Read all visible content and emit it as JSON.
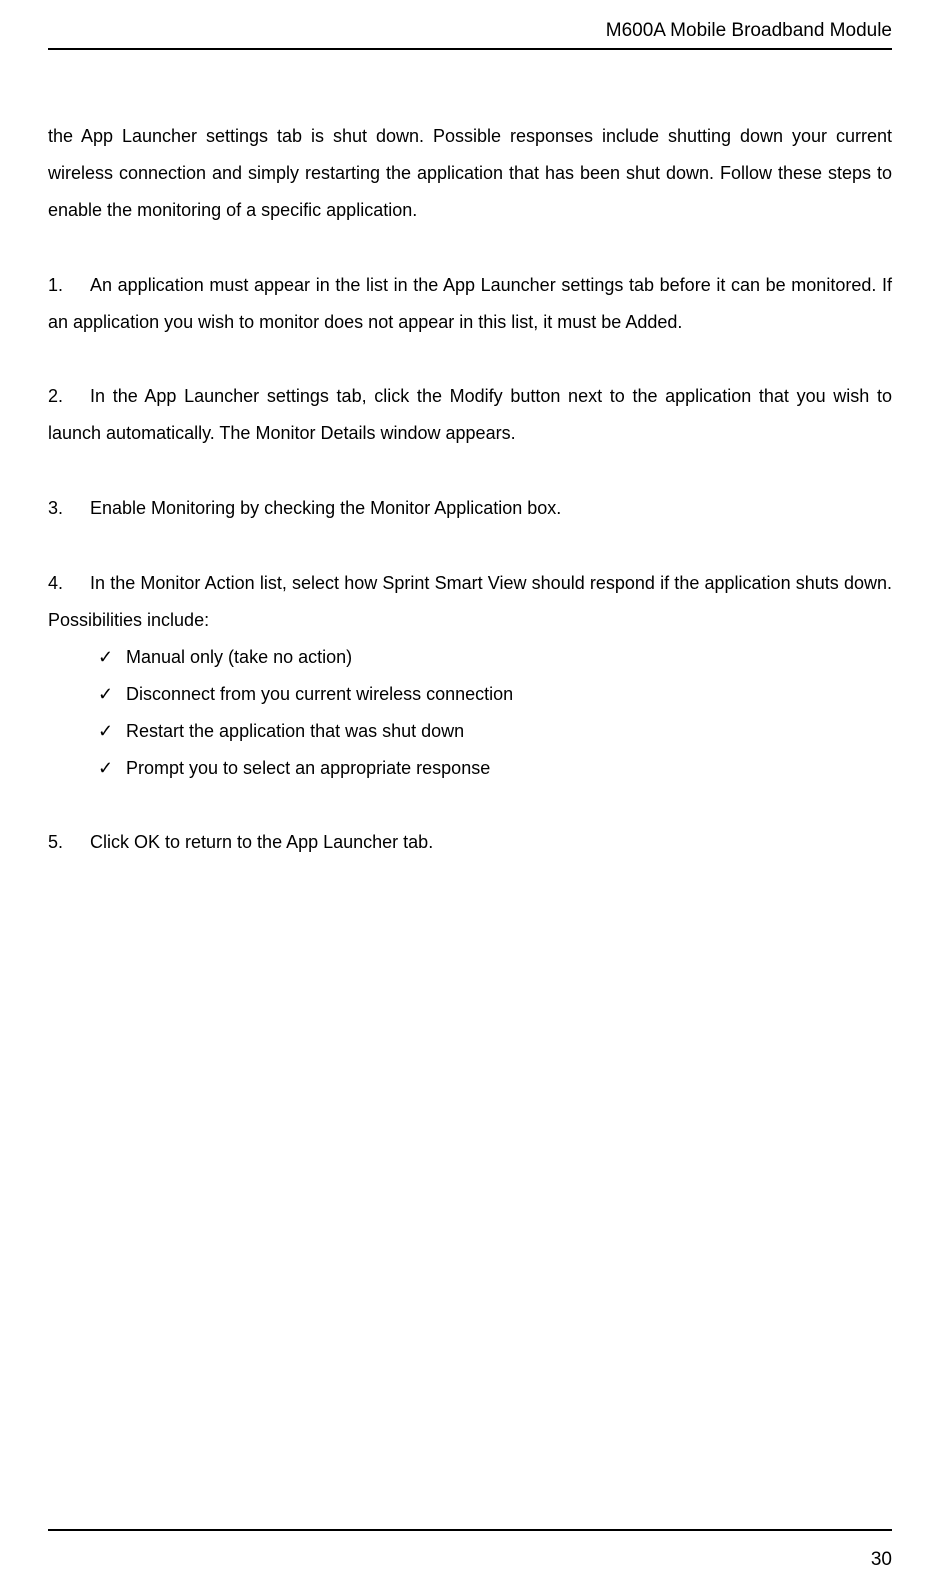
{
  "header": {
    "title": "M600A Mobile Broadband Module"
  },
  "intro": {
    "text": "the App Launcher settings tab is shut down. Possible responses include shutting down your current wireless connection and simply restarting the application that has been shut down. Follow these steps to enable the monitoring of a specific application."
  },
  "steps": {
    "s1": {
      "num": "1.",
      "text": "An application must appear in the list in the App Launcher settings tab before it can be monitored. If an application you wish to monitor does not appear in this list, it must be Added."
    },
    "s2": {
      "num": "2.",
      "text": "In the App Launcher settings tab, click the Modify button next to the application that you wish to launch automatically. The Monitor Details window appears."
    },
    "s3": {
      "num": "3.",
      "text": "Enable Monitoring by checking the Monitor Application box."
    },
    "s4": {
      "num": "4.",
      "text": "In the Monitor Action list, select how Sprint Smart View should respond if the application shuts down. Possibilities include:"
    },
    "s5": {
      "num": "5.",
      "text": "Click OK to return to the App Launcher tab."
    }
  },
  "checks": {
    "c1": "Manual only (take no action)",
    "c2": "Disconnect from you current wireless connection",
    "c3": "Restart the application that was shut down",
    "c4": "Prompt you to select an appropriate response"
  },
  "footer": {
    "page_number": "30"
  }
}
